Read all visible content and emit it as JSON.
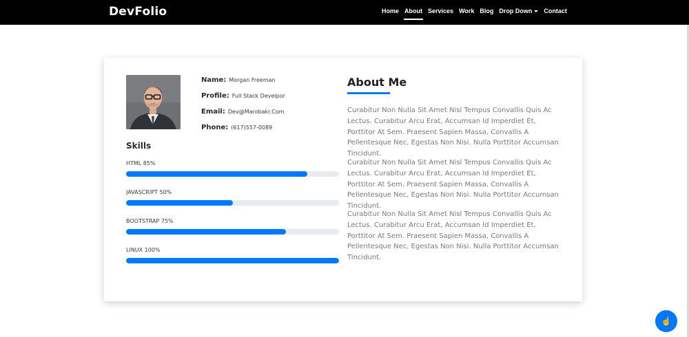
{
  "brand": "DevFolio",
  "nav": {
    "items": [
      "Home",
      "About",
      "Services",
      "Work",
      "Blog",
      "Drop Down",
      "Contact"
    ],
    "active": "About"
  },
  "profile": {
    "name_label": "Name:",
    "name": "Morgan Freeman",
    "profile_label": "Profile:",
    "profile": "Full Stack Develpor",
    "email_label": "Email:",
    "email": "Dev@Marobakr.Com",
    "phone_label": "Phone:",
    "phone": "(617)557-0089"
  },
  "skills": {
    "title": "Skills",
    "items": [
      {
        "label": "HTML 85%",
        "percent": 85
      },
      {
        "label": "JAVASCRIPT 50%",
        "percent": 50
      },
      {
        "label": "BOOTSTRAP 75%",
        "percent": 75
      },
      {
        "label": "LINUX 100%",
        "percent": 100
      }
    ]
  },
  "about": {
    "title": "About Me",
    "paragraphs": [
      "Curabitur Non Nulla Sit Amet Nisl Tempus Convallis Quis Ac Lectus. Curabitur Arcu Erat, Accumsan Id Imperdiet Et, Porttitor At Sem. Praesent Sapien Massa, Convallis A Pellentesque Nec, Egestas Non Nisi. Nulla Porttitor Accumsan Tincidunt.",
      "Curabitur Non Nulla Sit Amet Nisl Tempus Convallis Quis Ac Lectus. Curabitur Arcu Erat, Accumsan Id Imperdiet Et, Porttitor At Sem. Praesent Sapien Massa, Convallis A Pellentesque Nec, Egestas Non Nisi. Nulla Porttitor Accumsan Tincidunt.",
      "Curabitur Non Nulla Sit Amet Nisl Tempus Convallis Quis Ac Lectus. Curabitur Arcu Erat, Accumsan Id Imperdiet Et, Porttitor At Sem. Praesent Sapien Massa, Convallis A Pellentesque Nec, Egestas Non Nisi. Nulla Porttitor Accumsan Tincidunt."
    ]
  },
  "fab": {
    "icon": "pointing-hand-icon"
  },
  "colors": {
    "accent": "#0078ff",
    "navbar": "#000000",
    "track": "#e9ecef"
  }
}
